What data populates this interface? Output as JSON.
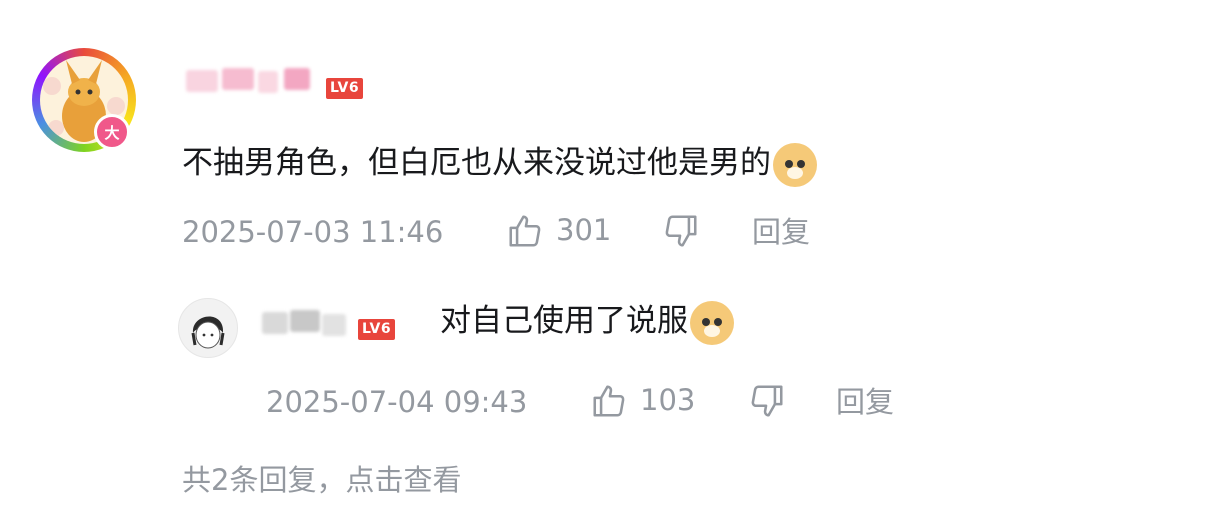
{
  "comment": {
    "level_badge": "LV6",
    "avatar_badge": "大",
    "text": "不抽男角色，但白厄也从来没说过他是男的",
    "timestamp": "2025-07-03 11:46",
    "like_count": "301",
    "reply_label": "回复"
  },
  "reply": {
    "level_badge": "LV6",
    "text": "对自己使用了说服",
    "timestamp": "2025-07-04 09:43",
    "like_count": "103",
    "reply_label": "回复"
  },
  "more_replies_label": "共2条回复，点击查看",
  "colors": {
    "text_primary": "#18191c",
    "text_secondary": "#9499a0",
    "level_badge": "#e8453c"
  },
  "icons": [
    "thumbs-up-icon",
    "thumbs-down-icon",
    "doge-emoji-icon"
  ]
}
